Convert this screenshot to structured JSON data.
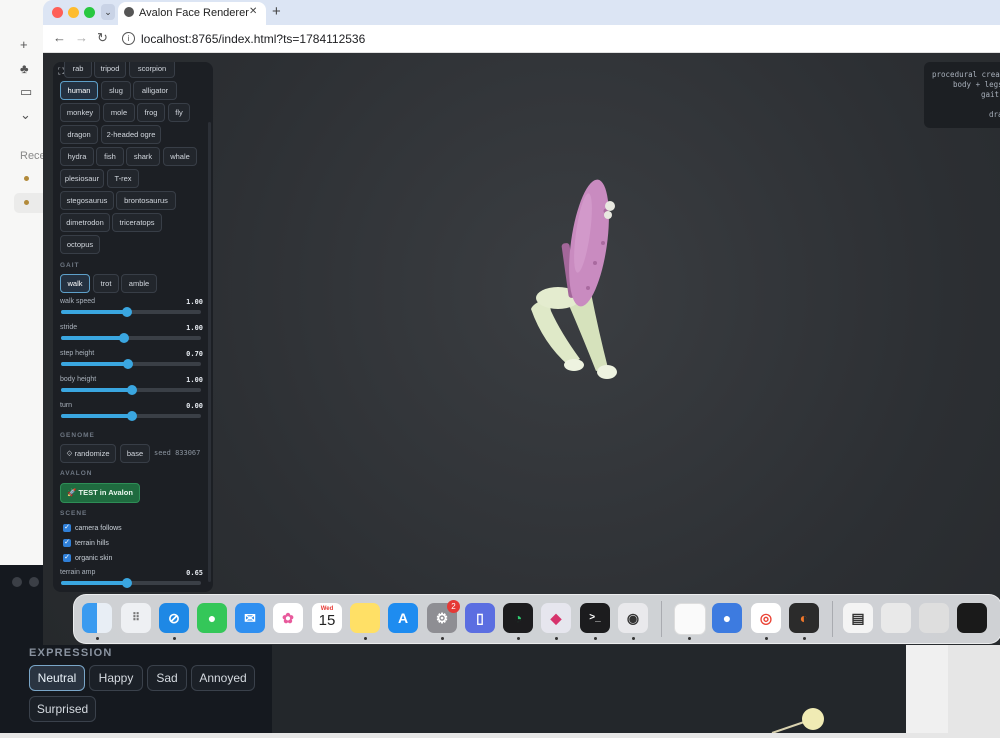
{
  "browser": {
    "tab_title": "Avalon Face Renderer",
    "close_symbol": "✕",
    "new_tab_symbol": "+",
    "url": "localhost:8765/index.html?ts=1784112536"
  },
  "background_app": {
    "recents_label": "Rece",
    "expression": {
      "title": "EXPRESSION",
      "buttons": [
        "Neutral",
        "Happy",
        "Sad",
        "Annoyed",
        "Surprised"
      ],
      "selected": "Neutral"
    }
  },
  "overlay": {
    "lines": [
      "procedural creatu",
      "body + legs",
      "gait",
      "dra"
    ]
  },
  "panel": {
    "species": [
      "rab",
      "tripod",
      "scorpion",
      "human",
      "slug",
      "alligator",
      "monkey",
      "mole",
      "frog",
      "fly",
      "dragon",
      "2-headed ogre",
      "hydra",
      "fish",
      "shark",
      "whale",
      "plesiosaur",
      "T-rex",
      "stegosaurus",
      "brontosaurus",
      "dimetrodon",
      "triceratops",
      "octopus"
    ],
    "selected_species": "human",
    "gait": {
      "title": "GAIT",
      "options": [
        "walk",
        "trot",
        "amble"
      ],
      "selected": "walk",
      "sliders": [
        {
          "label": "walk speed",
          "value": "1.00",
          "fraction": 0.47
        },
        {
          "label": "stride",
          "value": "1.00",
          "fraction": 0.45
        },
        {
          "label": "step height",
          "value": "0.70",
          "fraction": 0.48
        },
        {
          "label": "body height",
          "value": "1.00",
          "fraction": 0.51
        },
        {
          "label": "turn",
          "value": "0.00",
          "fraction": 0.51
        }
      ]
    },
    "genome": {
      "title": "GENOME",
      "randomize_label": "⟐ randomize",
      "base_label": "base",
      "seed_text": "seed 833067"
    },
    "avalon": {
      "title": "AVALON",
      "test_label": "🚀 TEST in Avalon"
    },
    "scene": {
      "title": "SCENE",
      "checkboxes": [
        {
          "label": "camera follows",
          "checked": true
        },
        {
          "label": "terrain hills",
          "checked": true
        },
        {
          "label": "organic skin",
          "checked": true
        }
      ],
      "terrain_amp": {
        "label": "terrain amp",
        "value": "0.65",
        "fraction": 0.47
      }
    }
  },
  "dock": {
    "calendar_day": "Wed",
    "calendar_date": "15",
    "settings_badge": "2",
    "terminal_glyph": ">_"
  },
  "colors": {
    "accent": "#3aa6e0",
    "avalon_green": "#1f6b3f",
    "creature_body": "#c98bc0",
    "creature_legs": "#dfe9c8"
  }
}
